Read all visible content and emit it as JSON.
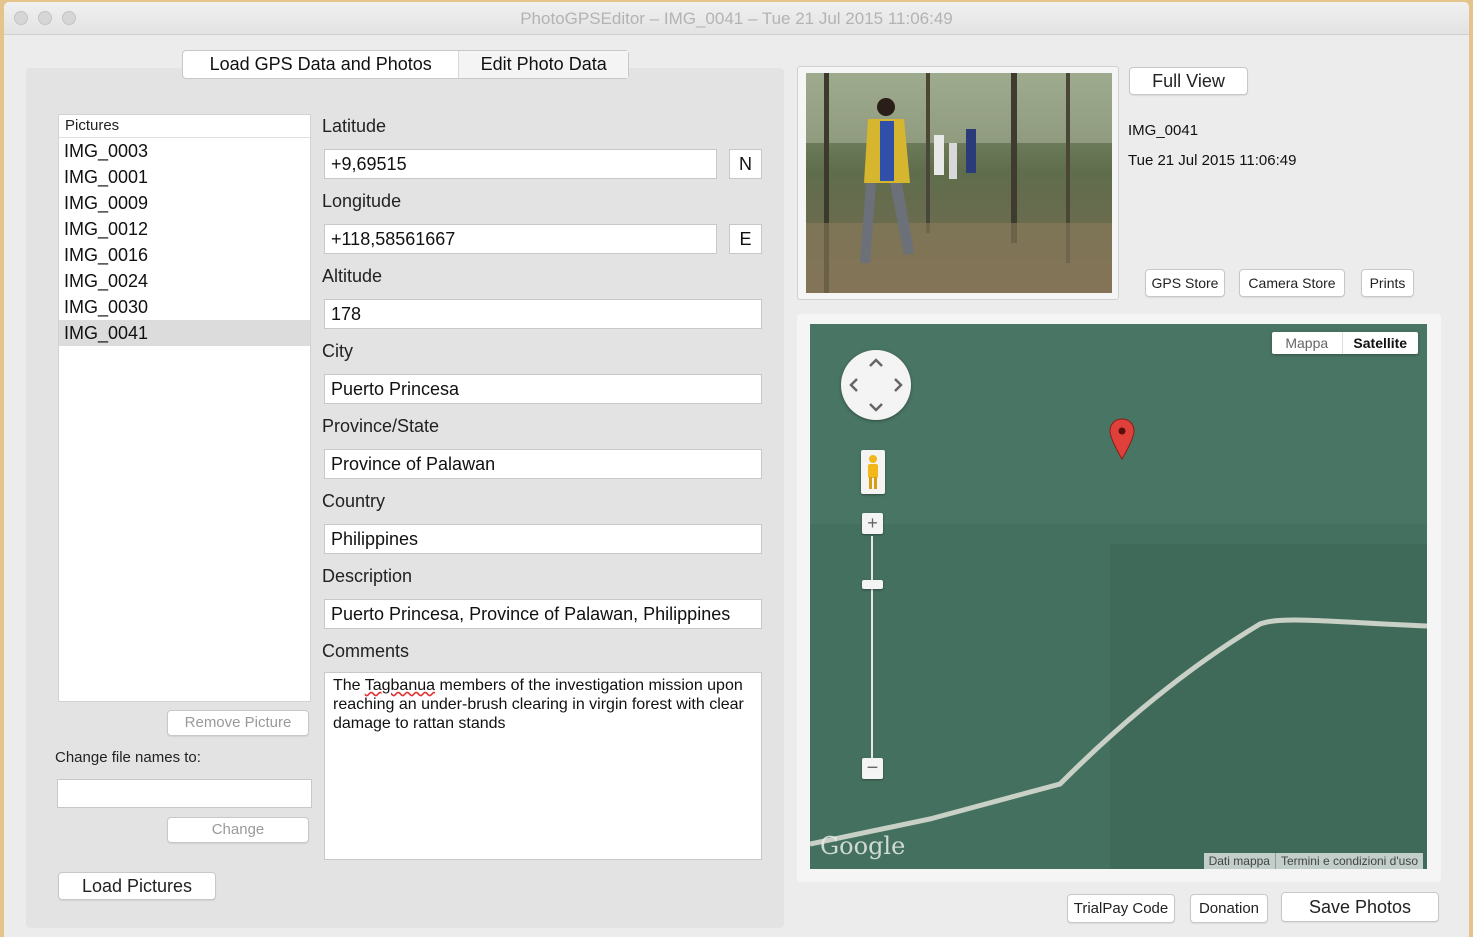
{
  "window": {
    "title": "PhotoGPSEditor – IMG_0041 – Tue 21 Jul 2015 11:06:49"
  },
  "tabs": [
    {
      "label": "Load GPS Data and Photos"
    },
    {
      "label": "Edit Photo Data"
    }
  ],
  "pictures": {
    "header": "Pictures",
    "items": [
      "IMG_0003",
      "IMG_0001",
      "IMG_0009",
      "IMG_0012",
      "IMG_0016",
      "IMG_0024",
      "IMG_0030",
      "IMG_0041"
    ],
    "selected": "IMG_0041",
    "remove_label": "Remove Picture",
    "change_names_label": "Change file names to:",
    "change_names_value": "",
    "change_label": "Change",
    "load_label": "Load Pictures"
  },
  "form": {
    "latitude_label": "Latitude",
    "latitude_value": "+9,69515",
    "latitude_hemisphere": "N",
    "longitude_label": "Longitude",
    "longitude_value": "+118,58561667",
    "longitude_hemisphere": "E",
    "altitude_label": "Altitude",
    "altitude_value": "178",
    "city_label": "City",
    "city_value": "Puerto Princesa",
    "province_label": "Province/State",
    "province_value": "Province of Palawan",
    "country_label": "Country",
    "country_value": "Philippines",
    "description_label": "Description",
    "description_value": "Puerto Princesa, Province of Palawan, Philippines",
    "comments_label": "Comments",
    "comments_word1": "The",
    "comments_word2": "Tagbanua",
    "comments_rest": "members of the investigation mission upon reaching an under-brush clearing in virgin forest with clear damage to rattan stands"
  },
  "photo_info": {
    "full_view_label": "Full View",
    "filename": "IMG_0041",
    "datetime": "Tue 21 Jul 2015 11:06:49",
    "gps_store_label": "GPS Store",
    "camera_store_label": "Camera Store",
    "prints_label": "Prints"
  },
  "map": {
    "type_map_label": "Mappa",
    "type_satellite_label": "Satellite",
    "brand": "Google",
    "map_data_label": "Dati mappa",
    "terms_label": "Termini e condizioni d'uso",
    "pin_color": "#e0403a"
  },
  "footer": {
    "trialpay_label": "TrialPay Code",
    "donation_label": "Donation",
    "save_label": "Save Photos"
  }
}
